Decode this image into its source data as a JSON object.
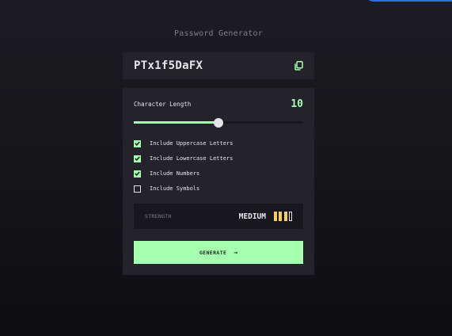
{
  "app": {
    "title": "Password Generator"
  },
  "password": {
    "value": "PTx1f5DaFX",
    "copy_icon": "copy-icon"
  },
  "length": {
    "label": "Character Length",
    "value": "10",
    "slider_fraction": 0.5
  },
  "options": [
    {
      "label": "Include Uppercase Letters",
      "checked": true
    },
    {
      "label": "Include Lowercase Letters",
      "checked": true
    },
    {
      "label": "Include Numbers",
      "checked": true
    },
    {
      "label": "Include Symbols",
      "checked": false
    }
  ],
  "strength": {
    "label": "STRENGTH",
    "level": "MEDIUM",
    "bars_filled": 3,
    "bars_total": 4,
    "bar_color": "#f8cd65"
  },
  "generate": {
    "label": "GENERATE",
    "icon": "arrow-right-icon"
  },
  "colors": {
    "accent": "#a4ffaf",
    "card": "#24232c",
    "inset": "#18171f",
    "muted": "#817d92",
    "text": "#e6e5ea",
    "strength_medium": "#f8cd65"
  }
}
